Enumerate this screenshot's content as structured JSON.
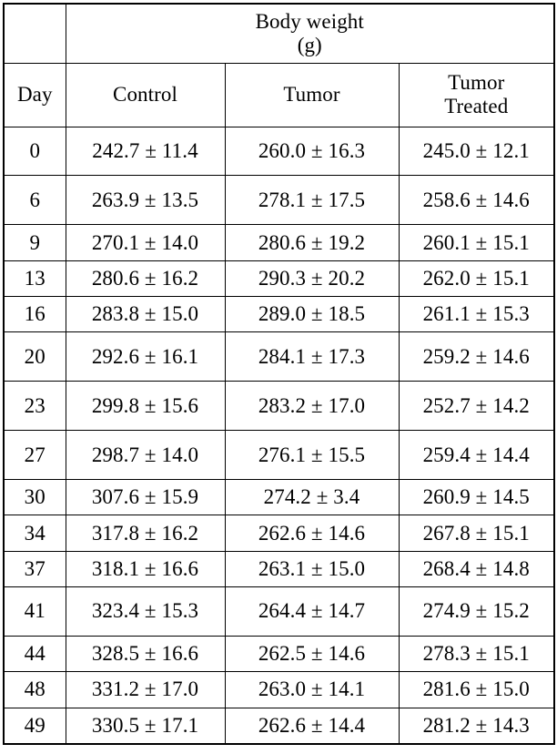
{
  "table": {
    "group_header": {
      "line1": "Body weight",
      "line2": "(g)"
    },
    "columns": [
      {
        "key": "day",
        "label_line1": "Day",
        "label_line2": ""
      },
      {
        "key": "ctrl",
        "label_line1": "Control",
        "label_line2": ""
      },
      {
        "key": "tumor",
        "label_line1": "Tumor",
        "label_line2": ""
      },
      {
        "key": "treat",
        "label_line1": "Tumor",
        "label_line2": "Treated"
      }
    ],
    "rows": [
      {
        "day": "0",
        "ctrl": "242.7 ± 11.4",
        "tumor": "260.0 ± 16.3",
        "treat": "245.0 ± 12.1",
        "size": "tall"
      },
      {
        "day": "6",
        "ctrl": "263.9 ± 13.5",
        "tumor": "278.1 ± 17.5",
        "treat": "258.6 ± 14.6",
        "size": "tall"
      },
      {
        "day": "9",
        "ctrl": "270.1 ± 14.0",
        "tumor": "280.6 ± 19.2",
        "treat": "260.1 ± 15.1",
        "size": "short"
      },
      {
        "day": "13",
        "ctrl": "280.6 ± 16.2",
        "tumor": "290.3 ± 20.2",
        "treat": "262.0 ± 15.1",
        "size": "short"
      },
      {
        "day": "16",
        "ctrl": "283.8 ± 15.0",
        "tumor": "289.0 ± 18.5",
        "treat": "261.1 ± 15.3",
        "size": "short"
      },
      {
        "day": "20",
        "ctrl": "292.6 ± 16.1",
        "tumor": "284.1 ± 17.3",
        "treat": "259.2 ± 14.6",
        "size": "tall"
      },
      {
        "day": "23",
        "ctrl": "299.8 ± 15.6",
        "tumor": "283.2 ± 17.0",
        "treat": "252.7 ± 14.2",
        "size": "tall"
      },
      {
        "day": "27",
        "ctrl": "298.7 ± 14.0",
        "tumor": "276.1 ± 15.5",
        "treat": "259.4 ± 14.4",
        "size": "tall"
      },
      {
        "day": "30",
        "ctrl": "307.6 ± 15.9",
        "tumor": "274.2 ± 3.4",
        "treat": "260.9 ± 14.5",
        "size": "short"
      },
      {
        "day": "34",
        "ctrl": "317.8 ± 16.2",
        "tumor": "262.6 ± 14.6",
        "treat": "267.8 ± 15.1",
        "size": "short"
      },
      {
        "day": "37",
        "ctrl": "318.1 ± 16.6",
        "tumor": "263.1 ± 15.0",
        "treat": "268.4 ± 14.8",
        "size": "short"
      },
      {
        "day": "41",
        "ctrl": "323.4 ± 15.3",
        "tumor": "264.4 ± 14.7",
        "treat": "274.9 ± 15.2",
        "size": "tall"
      },
      {
        "day": "44",
        "ctrl": "328.5 ± 16.6",
        "tumor": "262.5 ± 14.6",
        "treat": "278.3 ± 15.1",
        "size": "short"
      },
      {
        "day": "48",
        "ctrl": "331.2 ± 17.0",
        "tumor": "263.0 ± 14.1",
        "treat": "281.6 ± 15.0",
        "size": "short"
      },
      {
        "day": "49",
        "ctrl": "330.5 ± 17.1",
        "tumor": "262.6 ± 14.4",
        "treat": "281.2 ± 14.3",
        "size": "short"
      }
    ]
  }
}
